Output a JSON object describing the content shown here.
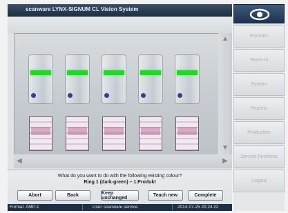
{
  "window": {
    "title": "scanware LYNX-SIGNUM CL Vision System"
  },
  "sidebar": {
    "logo_icon": "eye-icon",
    "items": [
      {
        "label": "Formats"
      },
      {
        "label": "Teach-in"
      },
      {
        "label": "System"
      },
      {
        "label": "Reports"
      },
      {
        "label": "Production"
      },
      {
        "label": "Service functions"
      },
      {
        "label": "Logout"
      }
    ]
  },
  "dialog": {
    "question": "What do you want to do with the following existing colour?",
    "detail": "Ring 1 (dark-green) – 1.Produkt",
    "buttons": [
      {
        "label": "Abort"
      },
      {
        "label": "Back"
      },
      {
        "label": "Keep unchanged"
      },
      {
        "label": "Teach new"
      },
      {
        "label": "Complete"
      }
    ]
  },
  "statusbar": {
    "format_label": "Format",
    "format_value": "AMP-1",
    "user_label": "User",
    "user_value": "scanware service",
    "datetime": "2014-07-25 20:24:22"
  },
  "colors": {
    "titlebar": "#2b3e57",
    "ring_highlight": "#28d428",
    "sidebar_text_disabled": "#a9b0b7"
  }
}
